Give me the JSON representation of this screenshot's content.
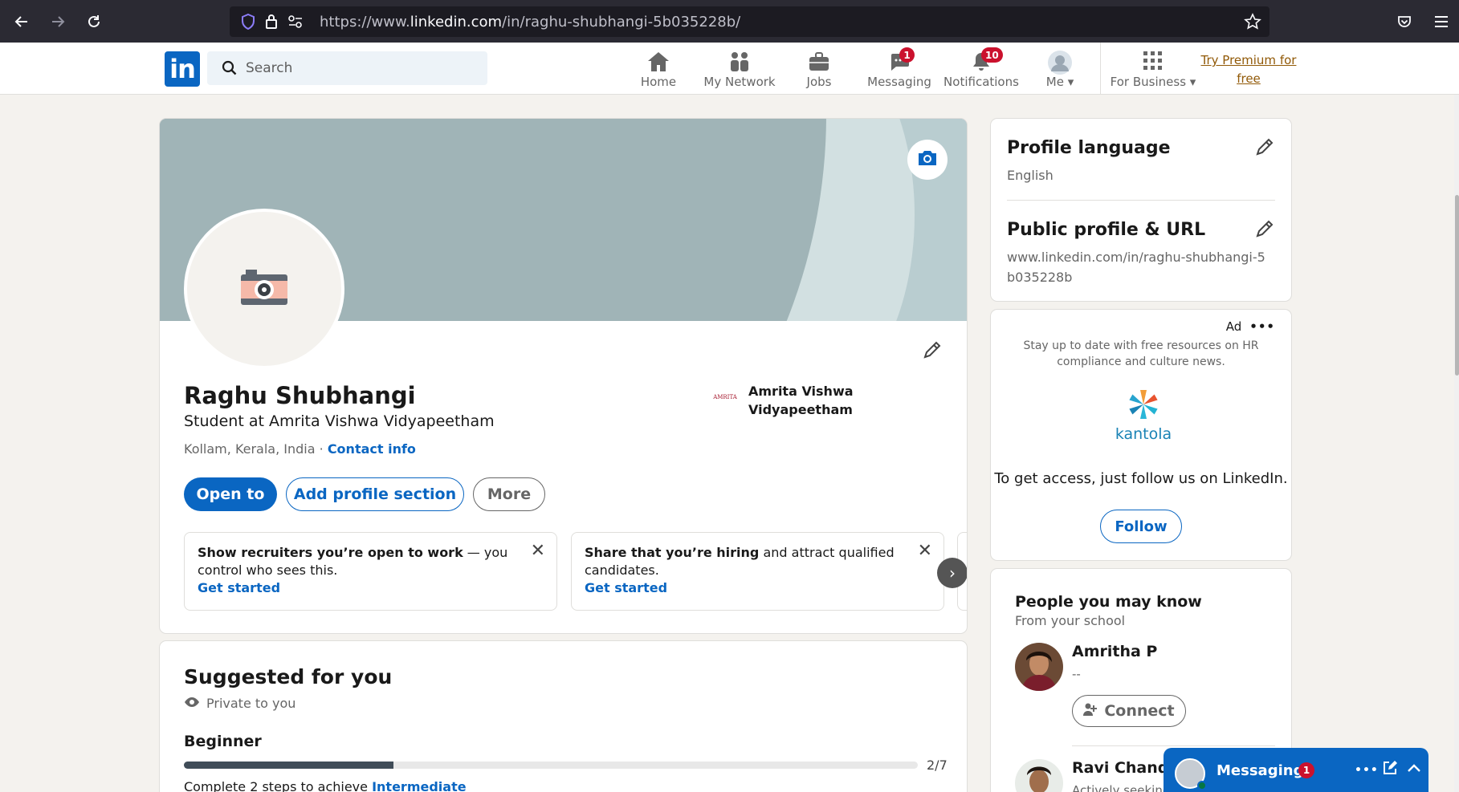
{
  "browser": {
    "url_prefix": "https://www.",
    "url_domain": "linkedin.com",
    "url_path": "/in/raghu-shubhangi-5b035228b/"
  },
  "nav": {
    "search_placeholder": "Search",
    "home": "Home",
    "network": "My Network",
    "jobs": "Jobs",
    "messaging": "Messaging",
    "messaging_count": "1",
    "notifications": "Notifications",
    "notifications_count": "10",
    "me": "Me",
    "for_business": "For Business",
    "premium": "Try Premium for free"
  },
  "profile": {
    "name": "Raghu Shubhangi",
    "headline": "Student at Amrita Vishwa Vidyapeetham",
    "location": "Kollam, Kerala, India",
    "separator": " · ",
    "contact_info": "Contact info",
    "school_name": "Amrita Vishwa Vidyapeetham",
    "school_logo_text": "AMRITA",
    "btn_open_to": "Open to",
    "btn_add_section": "Add profile section",
    "btn_more": "More"
  },
  "prompts": [
    {
      "bold": "Show recruiters you’re open to work",
      "text": " — you control who sees this.",
      "cta": "Get started"
    },
    {
      "bold": "Share that you’re hiring",
      "text": " and attract qualified candidates.",
      "cta": "Get started"
    }
  ],
  "suggested": {
    "title": "Suggested for you",
    "private": "Private to you",
    "level": "Beginner",
    "progress_done": 2,
    "progress_total": 7,
    "progress_text": "2/7",
    "footer_prefix": "Complete 2 steps to achieve ",
    "footer_link": "Intermediate"
  },
  "sidebar": {
    "lang_title": "Profile language",
    "lang_value": "English",
    "url_title": "Public profile & URL",
    "url_value": "www.linkedin.com/in/raghu-shubhangi-5b035228b"
  },
  "ad": {
    "label": "Ad",
    "text": "Stay up to date with free resources on HR compliance and culture news.",
    "brand": "kantola",
    "cta": "To get access, just follow us on LinkedIn.",
    "follow": "Follow"
  },
  "pymk": {
    "title": "People you may know",
    "subtitle": "From your school",
    "people": [
      {
        "name": "Amritha P",
        "desc": "--",
        "action": "Connect"
      },
      {
        "name": "Ravi Chandra",
        "desc": "Actively seeking"
      }
    ]
  },
  "messaging_bar": {
    "title": "Messaging",
    "count": "1"
  }
}
